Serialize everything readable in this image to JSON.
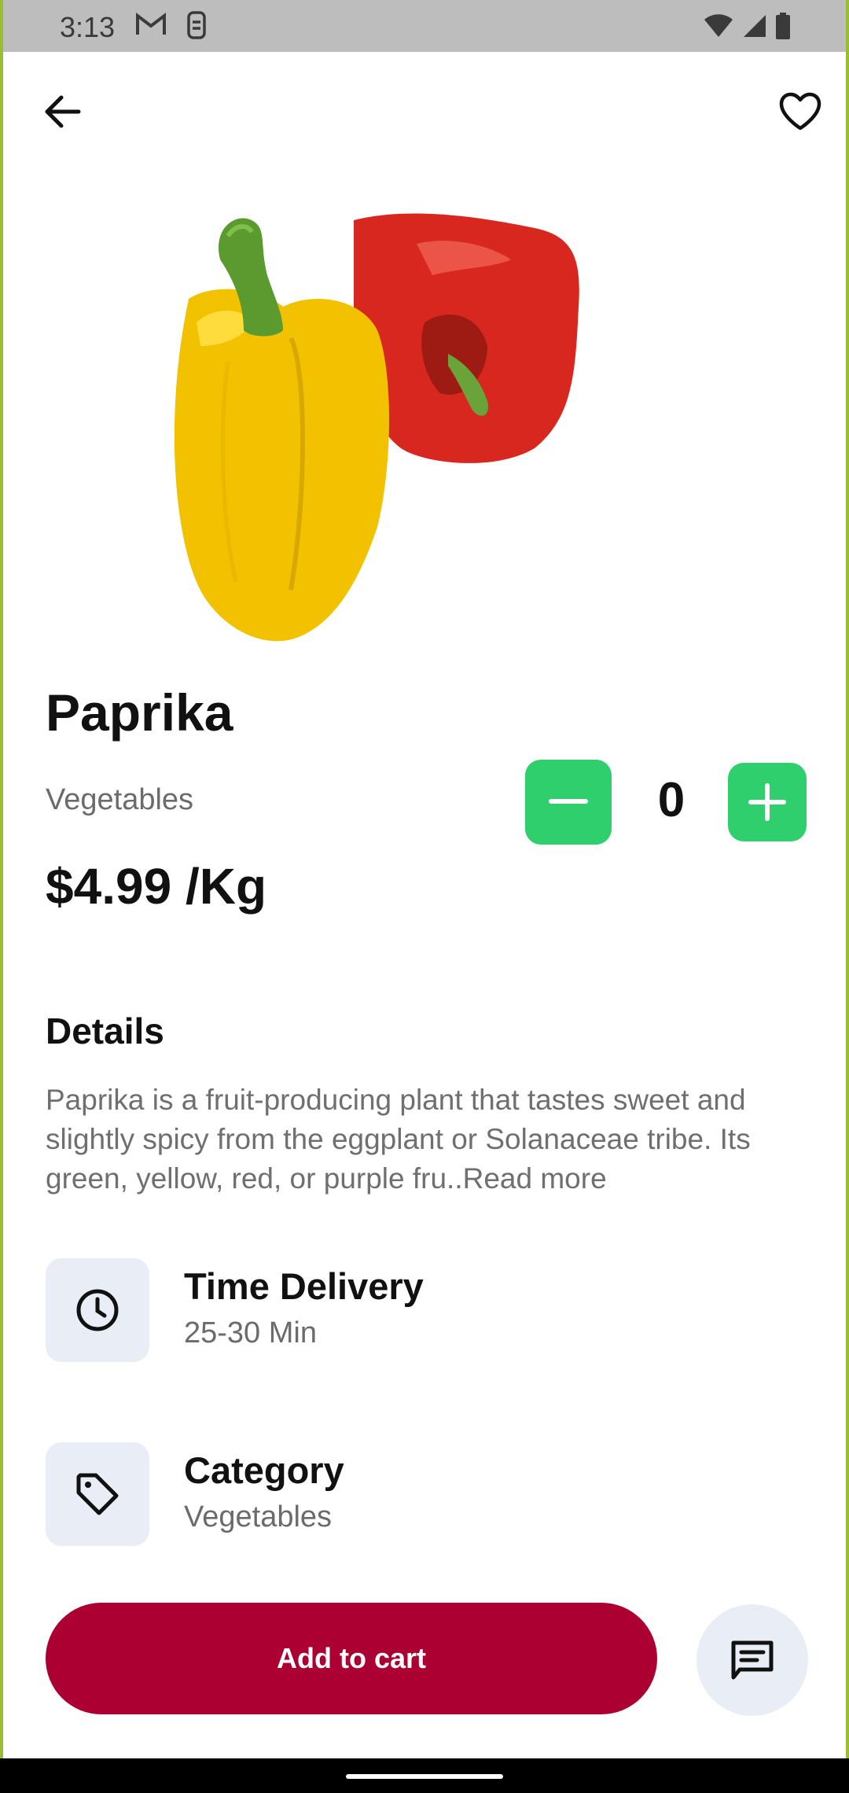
{
  "status_bar": {
    "time": "3:13"
  },
  "product": {
    "title": "Paprika",
    "category": "Vegetables",
    "price": "$4.99 /Kg"
  },
  "quantity": {
    "value": "0"
  },
  "details": {
    "heading": "Details",
    "text": "Paprika is a fruit-producing plant that tastes sweet and slightly spicy from the eggplant or Solanaceae tribe. Its green, yellow, red, or purple fru..",
    "read_more": "Read more"
  },
  "info": {
    "delivery": {
      "title": "Time Delivery",
      "value": "25-30 Min",
      "icon": "clock-icon"
    },
    "category": {
      "title": "Category",
      "value": "Vegetables",
      "icon": "tag-icon"
    }
  },
  "actions": {
    "add_to_cart": "Add to cart"
  },
  "colors": {
    "accent_green": "#2fcf6d",
    "primary": "#ac0033",
    "icon_bg": "#e9eef6"
  }
}
